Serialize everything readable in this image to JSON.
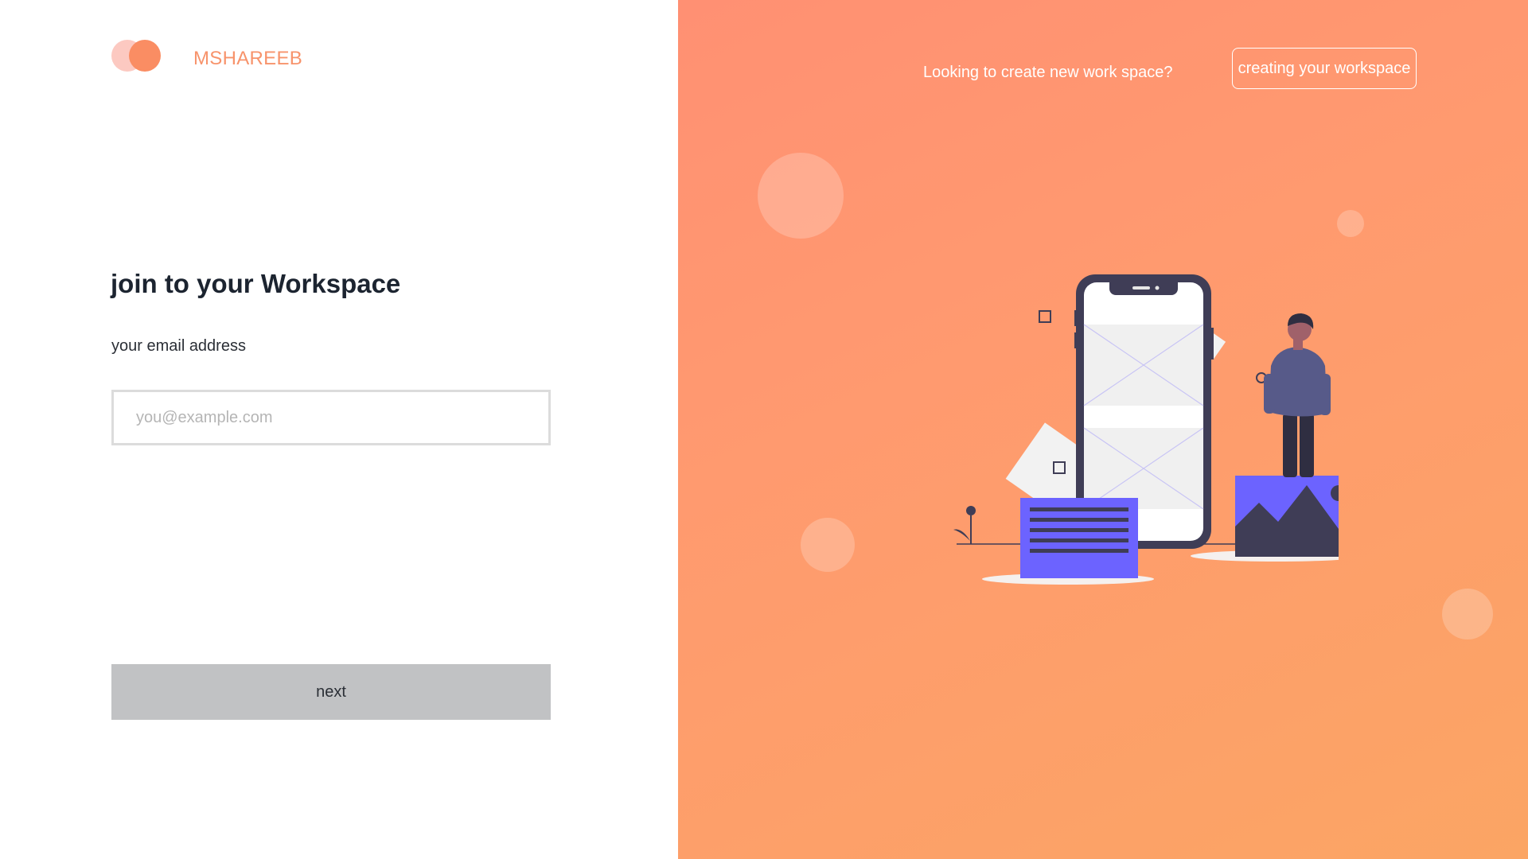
{
  "brand": {
    "name": "MSHAREEB"
  },
  "login": {
    "title": "join to your Workspace",
    "email_label": "your email address",
    "email_placeholder": "you@example.com",
    "email_value": "",
    "next_label": "next"
  },
  "header": {
    "prompt": "Looking to create new work space?",
    "create_button_label": "creating your workspace"
  },
  "colors": {
    "accent": "#f7936b",
    "gradient_start": "#ff9073",
    "gradient_end": "#fba564",
    "button_disabled": "#c1c2c4"
  },
  "icons": [
    "logo-icon",
    "phone-wireframe-illustration",
    "person-illustration",
    "mountain-image-icon",
    "document-card-icon"
  ]
}
